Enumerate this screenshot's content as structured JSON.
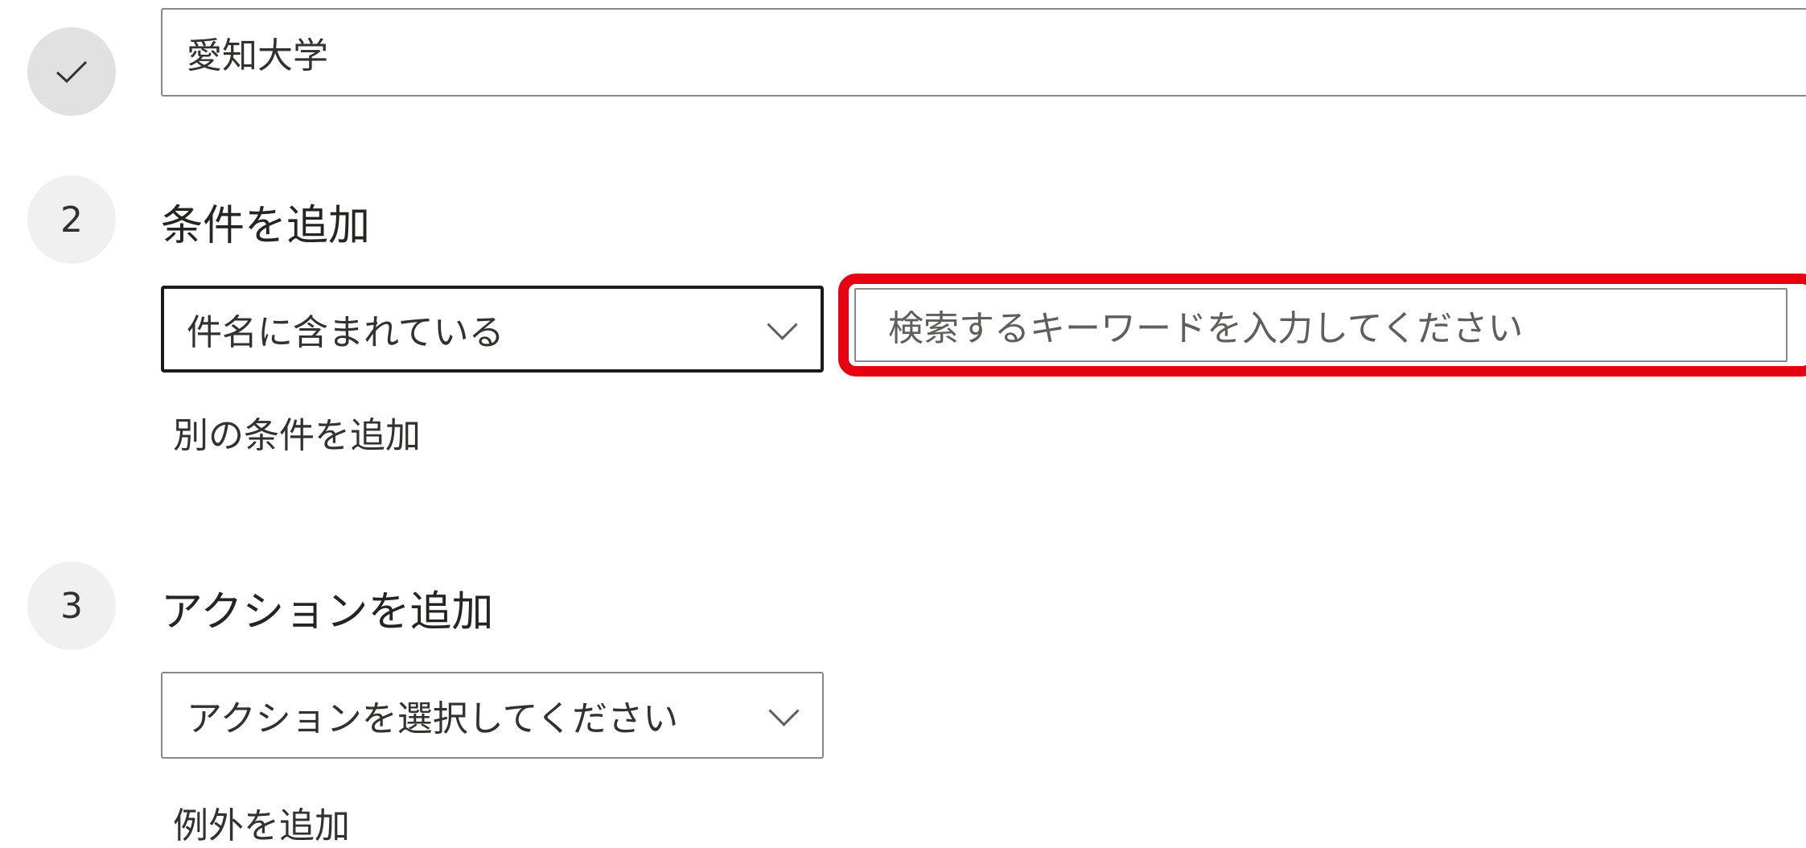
{
  "step1": {
    "icon": "check-icon",
    "value": "愛知大学"
  },
  "step2": {
    "number": "2",
    "title": "条件を追加",
    "condition_select": "件名に含まれている",
    "keyword_placeholder": "検索するキーワードを入力してください",
    "add_another": "別の条件を追加"
  },
  "step3": {
    "number": "3",
    "title": "アクションを追加",
    "action_select": "アクションを選択してください",
    "add_exception": "例外を追加"
  },
  "colors": {
    "highlight": "#e60012",
    "step_circle": "#f0f0f0",
    "text": "#323130"
  }
}
